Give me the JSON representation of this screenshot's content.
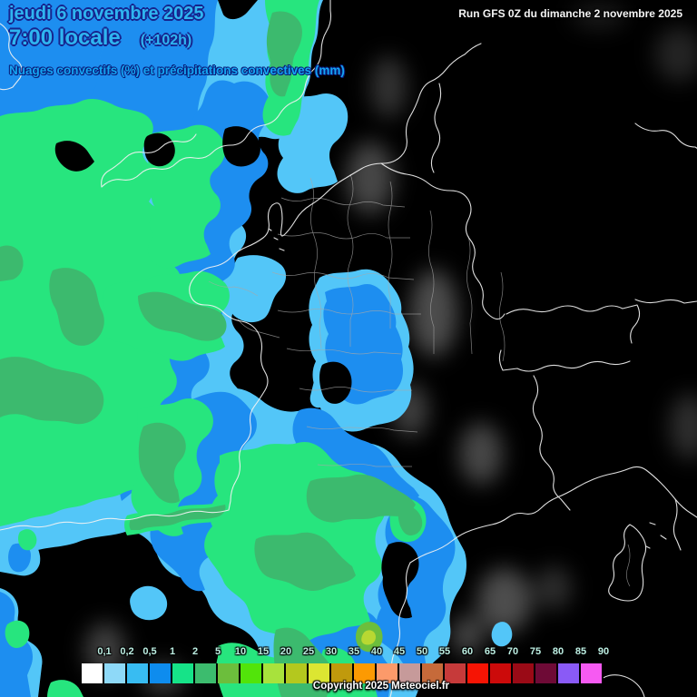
{
  "header": {
    "date_line": "jeudi 6 novembre 2025",
    "time_line": "7:00 locale",
    "forecast_offset": "(+102h)",
    "subtitle": "Nuages convectifs (%) et précipitations convectives (mm)",
    "run_info": "Run GFS 0Z du dimanche 2 novembre 2025"
  },
  "footer": {
    "copyright": "Copyright 2025 Meteociel.fr"
  },
  "legend": {
    "ticks": [
      "0,1",
      "0,2",
      "0,5",
      "1",
      "2",
      "5",
      "10",
      "15",
      "20",
      "25",
      "30",
      "35",
      "40",
      "45",
      "50",
      "55",
      "60",
      "65",
      "70",
      "75",
      "80",
      "85",
      "90"
    ],
    "colors": [
      "#FFFFFF",
      "#8ED9F8",
      "#38BCF2",
      "#0E8CEE",
      "#16E388",
      "#3CBC6E",
      "#6CBE3C",
      "#52E40A",
      "#A8E23C",
      "#B4C81E",
      "#DCE632",
      "#C09A0C",
      "#FC9A02",
      "#FC9A6A",
      "#C69A9A",
      "#C66A3A",
      "#C63A3A",
      "#F61404",
      "#CC0A0A",
      "#9A0A16",
      "#6E0A36",
      "#8A5AF6",
      "#F65AF2"
    ]
  },
  "map_colors": {
    "background": "#000000",
    "coastline": "#F2F2F2",
    "department_border": "#A8A8A8",
    "precip_02": "#53C6F8",
    "precip_05": "#1D8EF0",
    "precip_1": "#27E57E",
    "precip_2": "#3CBA6E",
    "precip_5": "#6CBE3C",
    "precip_15": "#B8D832",
    "title_text": "#2FB5F0",
    "cloud_shade": "#FFFFFF"
  }
}
